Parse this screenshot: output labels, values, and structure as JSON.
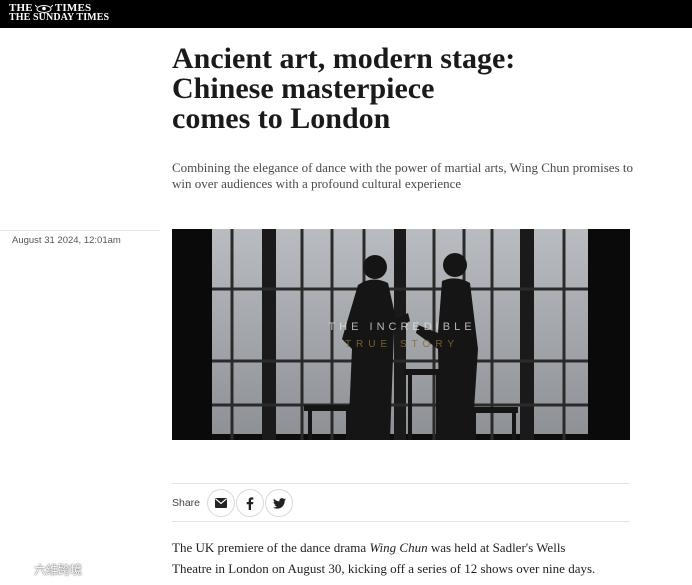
{
  "masthead": {
    "line1_left": "THE",
    "line1_right": "TIMES",
    "line2": "THE SUNDAY TIMES"
  },
  "article": {
    "headline_1": "Ancient art, modern stage:",
    "headline_2": "Chinese masterpiece",
    "headline_3": "comes to London",
    "standfirst": "Combining the elegance of dance with the power of martial arts, Wing Chun promises to win over audiences with a profound cultural experience",
    "dateline": "August 31 2024, 12:01am"
  },
  "hero_image": {
    "overlay_line1": "THE INCREDIBLE",
    "overlay_line2": "TRUE STORY"
  },
  "share": {
    "label": "Share",
    "icons": [
      "mail-icon",
      "facebook-icon",
      "twitter-icon"
    ]
  },
  "body": {
    "p1_a": "The UK premiere of the dance drama ",
    "p1_italic": "Wing Chun",
    "p1_b": " was held at Sadler's Wells",
    "p1_line2": "Theatre in London on August 30, kicking off a series of 12 shows over nine days."
  },
  "watermark": {
    "text": "六维跨境"
  }
}
